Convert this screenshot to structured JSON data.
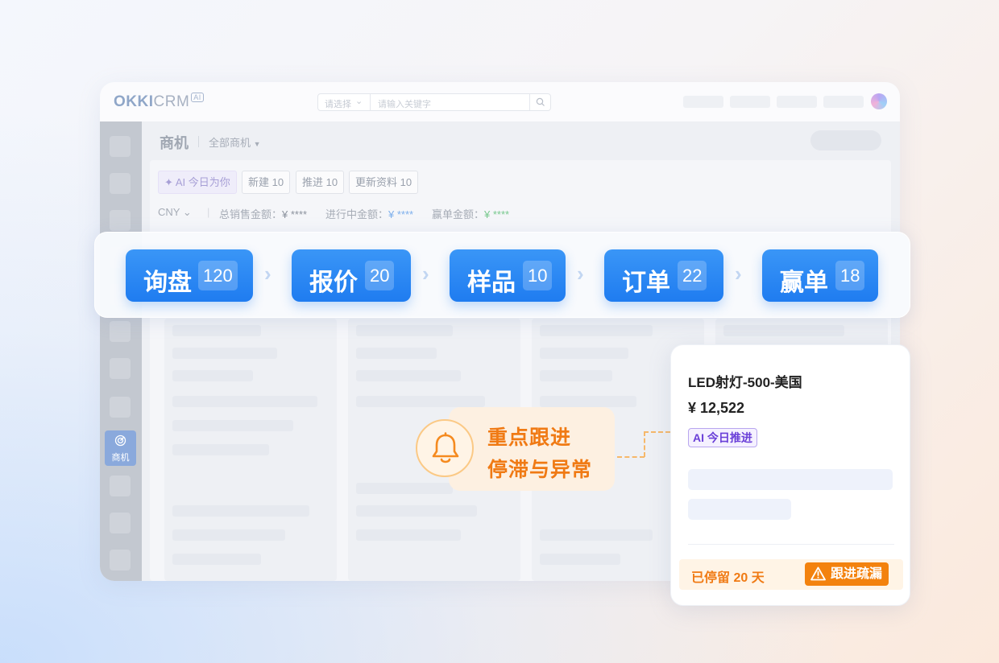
{
  "app": {
    "logo_text": "OKKI",
    "logo_crm": "CRM",
    "logo_badge": "AI",
    "search": {
      "select_label": "请选择",
      "placeholder": "请输入关键字"
    }
  },
  "sidebar": {
    "active_item_label": "商机"
  },
  "page": {
    "title": "商机",
    "filter_label": "全部商机",
    "chips": [
      {
        "label": "AI 今日为你"
      },
      {
        "label": "新建 10"
      },
      {
        "label": "推进 10"
      },
      {
        "label": "更新资料 10"
      }
    ],
    "currency": "CNY",
    "totals": [
      {
        "label": "总销售金额：",
        "value": "¥ ****"
      },
      {
        "label": "进行中金额：",
        "value": "¥ ****"
      },
      {
        "label": "赢单金额：",
        "value": "¥ ****"
      }
    ]
  },
  "pipeline": {
    "stages": [
      {
        "name": "询盘",
        "count": "120"
      },
      {
        "name": "报价",
        "count": "20"
      },
      {
        "name": "样品",
        "count": "10"
      },
      {
        "name": "订单",
        "count": "22"
      },
      {
        "name": "赢单",
        "count": "18"
      }
    ]
  },
  "callout": {
    "line1": "重点跟进",
    "line2": "停滞与异常"
  },
  "detail_card": {
    "title": "LED射灯-500-美国",
    "amount": "¥ 12,522",
    "ai_tag": "AI 今日推进",
    "stay_text": "已停留 20 天",
    "warning_label": "跟进疏漏"
  },
  "colors": {
    "accent_blue": "#1f7cf0",
    "warning_orange": "#f07a14",
    "ai_purple": "#6a3fd8"
  }
}
